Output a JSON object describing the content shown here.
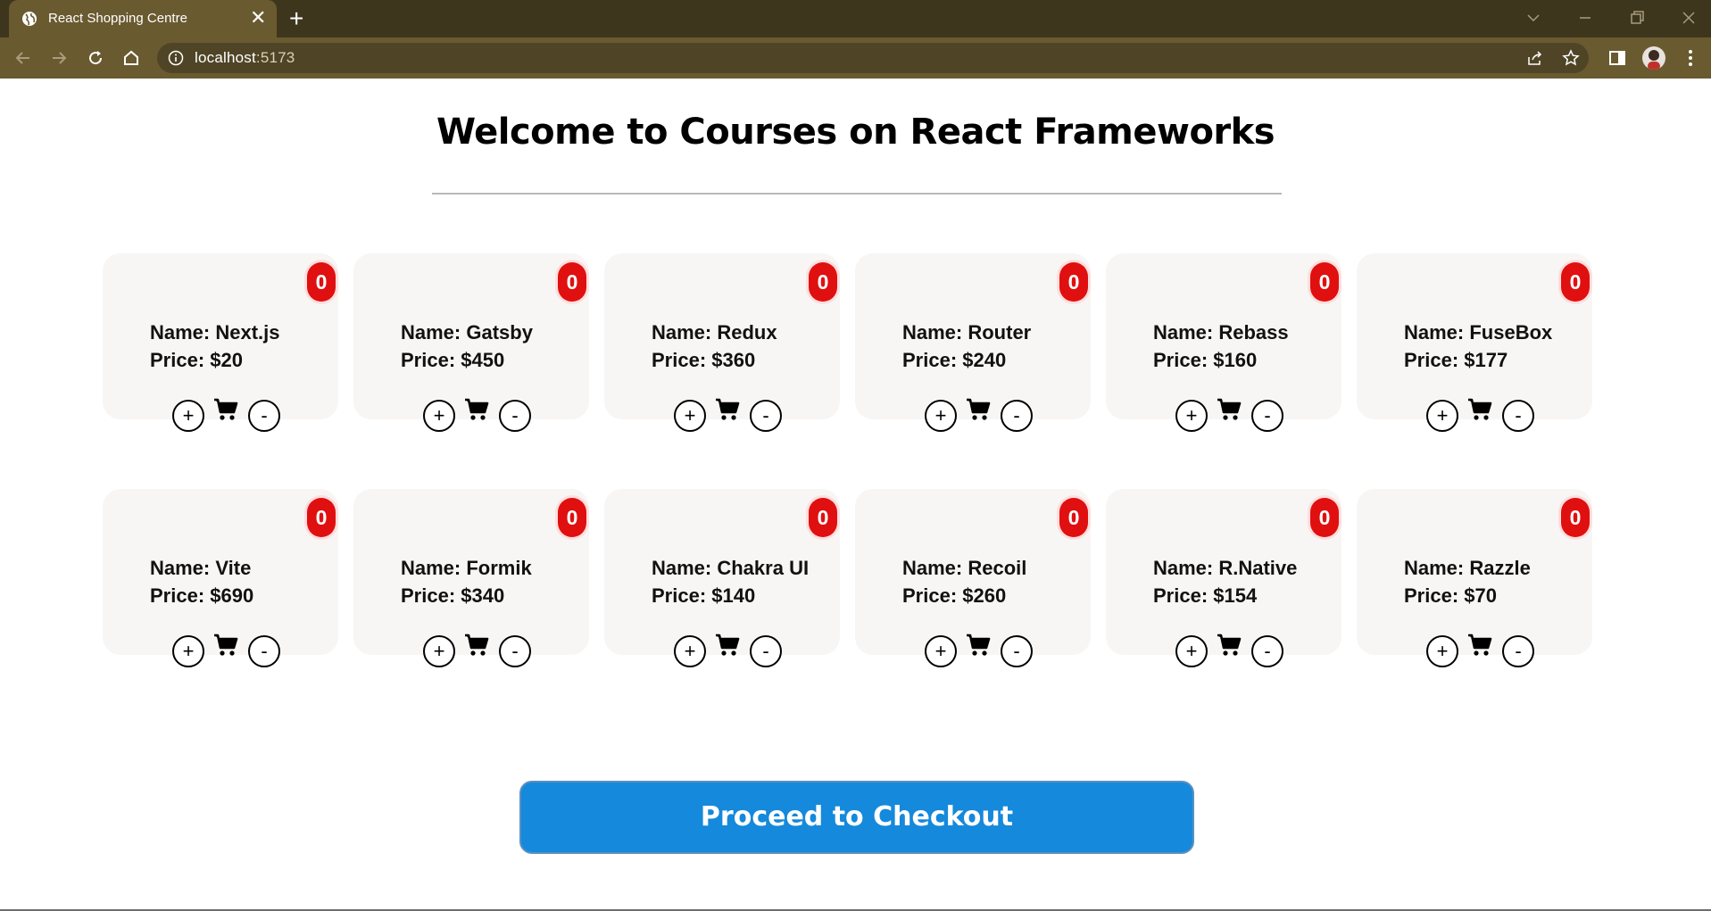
{
  "browser": {
    "tab_title": "React Shopping Centre",
    "tab_close": "✕",
    "new_tab": "+",
    "url_host": "localhost",
    "url_port": ":5173"
  },
  "page": {
    "title": "Welcome to Courses on React Frameworks",
    "checkout_label": "Proceed to Checkout"
  },
  "colors": {
    "badge": "#e01010",
    "checkout": "#1589db",
    "card_bg": "#f8f6f4"
  },
  "controls": {
    "plus": "+",
    "minus": "-"
  },
  "courses": [
    {
      "name": "Name: Next.js",
      "price": "Price: $20",
      "count": "0"
    },
    {
      "name": "Name: Gatsby",
      "price": "Price: $450",
      "count": "0"
    },
    {
      "name": "Name: Redux",
      "price": "Price: $360",
      "count": "0"
    },
    {
      "name": "Name: Router",
      "price": "Price: $240",
      "count": "0"
    },
    {
      "name": "Name: Rebass",
      "price": "Price: $160",
      "count": "0"
    },
    {
      "name": "Name: FuseBox",
      "price": "Price: $177",
      "count": "0"
    },
    {
      "name": "Name: Vite",
      "price": "Price: $690",
      "count": "0"
    },
    {
      "name": "Name: Formik",
      "price": "Price: $340",
      "count": "0"
    },
    {
      "name": "Name: Chakra UI",
      "price": "Price: $140",
      "count": "0"
    },
    {
      "name": "Name: Recoil",
      "price": "Price: $260",
      "count": "0"
    },
    {
      "name": "Name: R.Native",
      "price": "Price: $154",
      "count": "0"
    },
    {
      "name": "Name: Razzle",
      "price": "Price: $70",
      "count": "0"
    }
  ]
}
